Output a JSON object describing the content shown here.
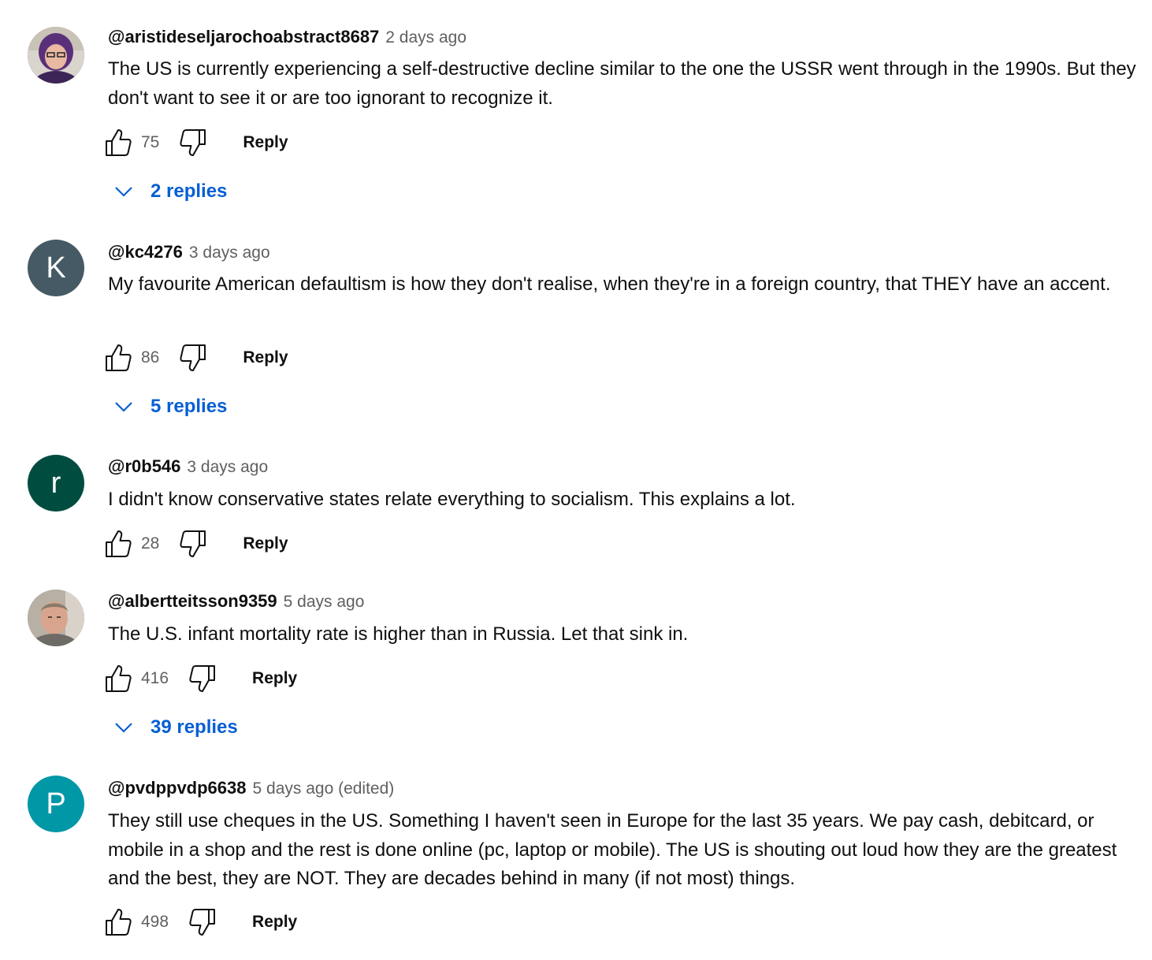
{
  "comments": [
    {
      "author": "@aristideseljarochoabstract8687",
      "time": "2 days ago",
      "text": "The US is currently experiencing a self-destructive decline similar to the one the USSR went through in the 1990s. But they don't want to see it or are too ignorant to recognize it.",
      "likes": "75",
      "reply_label": "Reply",
      "replies_label": "2 replies",
      "avatar": {
        "type": "photo",
        "color": "#6a3e86"
      }
    },
    {
      "author": "@kc4276",
      "time": "3 days ago",
      "text": "My favourite American defaultism is how they don't realise, when they're in a foreign country, that THEY have an accent.",
      "likes": "86",
      "reply_label": "Reply",
      "replies_label": "5 replies",
      "avatar": {
        "type": "letter",
        "letter": "K",
        "color": "#455a64"
      }
    },
    {
      "author": "@r0b546",
      "time": "3 days ago",
      "text": "I didn't know conservative states relate everything to socialism. This explains a lot.",
      "likes": "28",
      "reply_label": "Reply",
      "avatar": {
        "type": "letter",
        "letter": "r",
        "color": "#004d40"
      }
    },
    {
      "author": "@albertteitsson9359",
      "time": "5 days ago",
      "text": "The U.S. infant mortality rate  is higher than  in Russia. Let that sink in.",
      "likes": "416",
      "reply_label": "Reply",
      "replies_label": "39 replies",
      "avatar": {
        "type": "photo",
        "color": "#8a8278"
      }
    },
    {
      "author": "@pvdppvdp6638",
      "time": "5 days ago (edited)",
      "text": "They still use cheques in the US. Something I haven't seen in Europe for the last 35 years. We pay cash, debitcard, or mobile in a shop and the rest is done online (pc, laptop or mobile). The US is shouting out loud how they are the greatest and the best, they are NOT. They are decades behind in many (if not most) things.",
      "likes": "498",
      "reply_label": "Reply",
      "avatar": {
        "type": "letter",
        "letter": "P",
        "color": "#0097a7"
      }
    }
  ],
  "icons": {
    "like": "thumbs-up-icon",
    "dislike": "thumbs-down-icon",
    "expand": "chevron-down-icon"
  },
  "colors": {
    "link_blue": "#065fd4",
    "secondary_text": "#606060",
    "primary_text": "#0f0f0f"
  }
}
